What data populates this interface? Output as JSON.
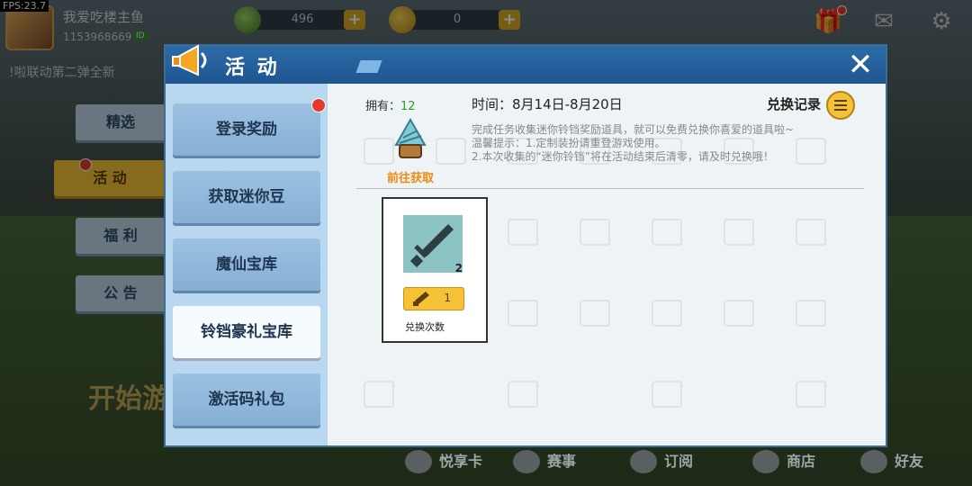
{
  "fps": "FPS:23.7",
  "user": {
    "name": "我爱吃楼主鱼",
    "id": "1153968669",
    "id_tag": "ID"
  },
  "currency": [
    {
      "name": "mini-bean",
      "value": "496",
      "plus": "+"
    },
    {
      "name": "mini-coin",
      "value": "0",
      "plus": "+"
    }
  ],
  "top_icons": [
    "gift-icon",
    "mail-icon",
    "settings-icon"
  ],
  "marquee": "!啦联动第二弹全新",
  "side_tabs": [
    "精选",
    "活 动",
    "福 利",
    "公 告"
  ],
  "start_text": "开始游",
  "bottom_bar": [
    "悦享卡",
    "赛事",
    "订阅",
    "商店",
    "好友"
  ],
  "modal": {
    "title": "活 动",
    "close": "✕",
    "menu": [
      "登录奖励",
      "获取迷你豆",
      "魔仙宝库",
      "铃铛豪礼宝库",
      "激活码礼包"
    ],
    "owned_label": "拥有：",
    "owned_value": "12",
    "time": "时间：8月14日-8月20日",
    "record": "兑换记录",
    "goto": "前往获取",
    "desc_line1": "完成任务收集迷你铃铛奖励道具，就可以免费兑换你喜爱的道具啦~",
    "desc_line2": "温馨提示：1.定制装扮请重登游戏使用。",
    "desc_line3": "2.本次收集的“迷你铃铛”将在活动结束后清零，请及时兑换哦！",
    "item": {
      "qty": "2",
      "cost": "1",
      "label": "兑换次数"
    }
  },
  "colors": {
    "accent": "#f5c135",
    "header": "#2d6ca8",
    "green": "#2a9a2a",
    "orange": "#f08a10"
  }
}
